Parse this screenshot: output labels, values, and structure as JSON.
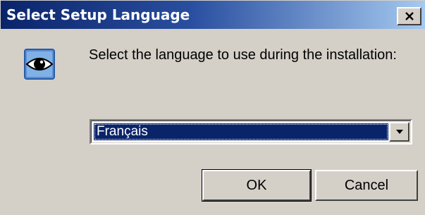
{
  "window": {
    "title": "Select Setup Language",
    "close_glyph": "×"
  },
  "icon": {
    "name": "eye-icon"
  },
  "prompt": "Select the language to use during the installation:",
  "language_select": {
    "selected": "Français",
    "arrow_icon": "dropdown-arrow-icon"
  },
  "buttons": {
    "ok": "OK",
    "cancel": "Cancel"
  },
  "colors": {
    "titlebar_start": "#0a246a",
    "titlebar_end": "#a6caf0",
    "face": "#d4d0c8",
    "selection": "#0a246a"
  }
}
